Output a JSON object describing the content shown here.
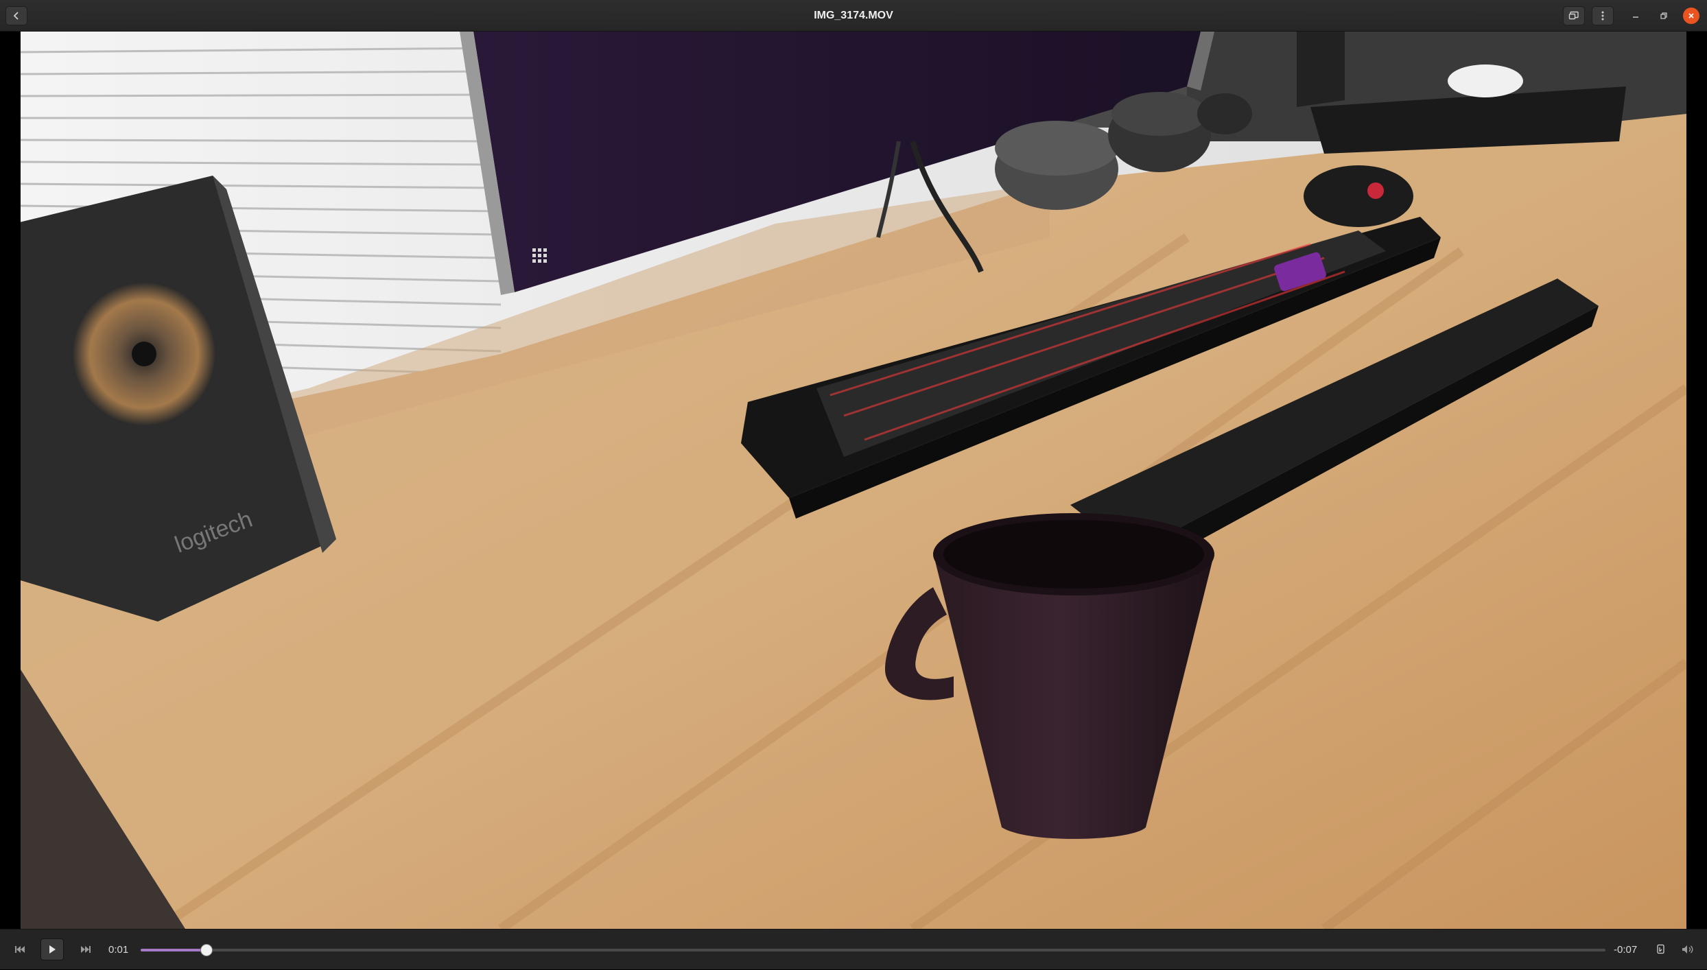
{
  "window": {
    "title": "IMG_3174.MOV"
  },
  "header": {
    "back_icon": "chevron-left-icon",
    "cast_icon": "screen-cast-icon",
    "menu_icon": "kebab-menu-icon",
    "minimize_icon": "minimize-icon",
    "maximize_icon": "restore-icon",
    "close_icon": "close-icon"
  },
  "video": {
    "description_scene": "desk"
  },
  "controls": {
    "previous_icon": "skip-previous-icon",
    "play_icon": "play-icon",
    "next_icon": "skip-next-icon",
    "elapsed": "0:01",
    "remaining": "-0:07",
    "progress_fraction": 0.045,
    "subtitles_icon": "subtitles-icon",
    "volume_icon": "volume-icon"
  },
  "colors": {
    "accent": "#a47ac7",
    "close": "#e95420",
    "bar": "#262626"
  }
}
